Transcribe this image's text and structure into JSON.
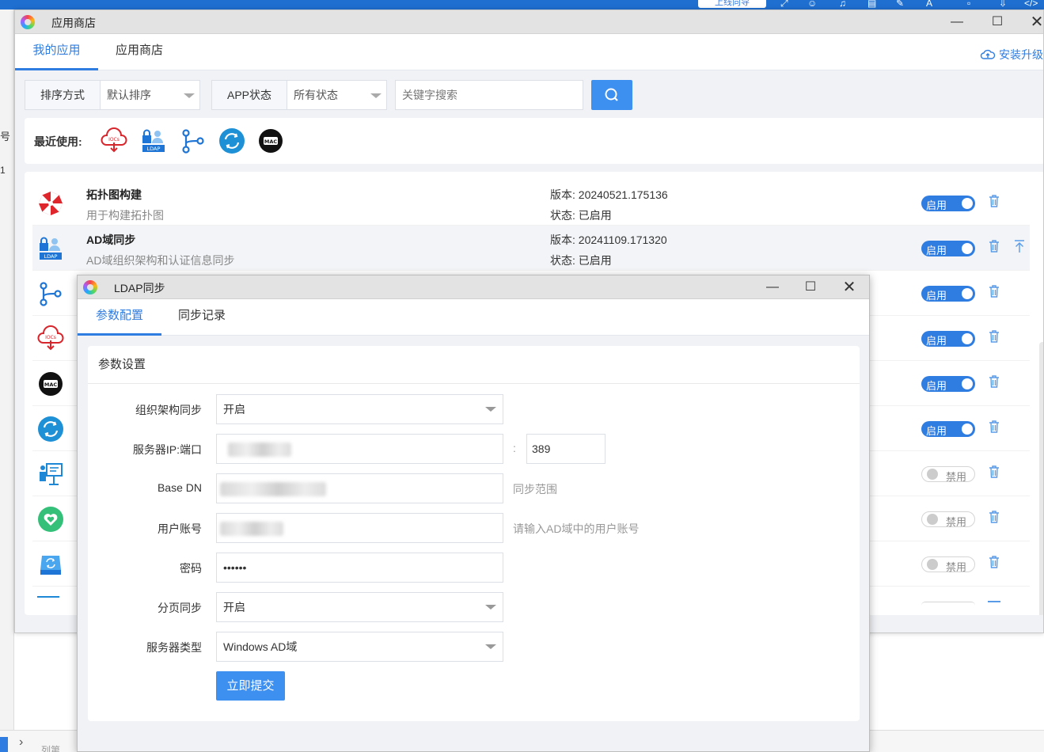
{
  "background": {
    "top_pill": "上线向导",
    "left_text_1": "号",
    "left_text_2": "1",
    "bottom_text": "列第"
  },
  "window": {
    "title": "应用商店",
    "tabs": [
      {
        "label": "我的应用",
        "active": true
      },
      {
        "label": "应用商店",
        "active": false
      }
    ],
    "upgrade_label": "安装升级",
    "filters": {
      "sort_label": "排序方式",
      "sort_value": "默认排序",
      "status_label": "APP状态",
      "status_value": "所有状态",
      "keyword_placeholder": "关键字搜索"
    },
    "recent": {
      "label": "最近使用:",
      "icons": [
        "iocs-cloud-icon",
        "ldap-icon",
        "branch-icon",
        "sync-icon",
        "mac-icon"
      ]
    },
    "apps": [
      {
        "name": "拓扑图构建",
        "desc": "用于构建拓扑图",
        "version_label": "版本:",
        "version": "20240521.175136",
        "status_label": "状态:",
        "status": "已启用",
        "toggle": "启用",
        "enabled": true,
        "icon": "umbrella-icon"
      },
      {
        "name": "AD域同步",
        "desc": "AD域组织架构和认证信息同步",
        "version_label": "版本:",
        "version": "20241109.171320",
        "status_label": "状态:",
        "status": "已启用",
        "toggle": "启用",
        "enabled": true,
        "icon": "ldap-icon"
      },
      {
        "toggle": "启用",
        "enabled": true,
        "icon": "branch-icon"
      },
      {
        "toggle": "启用",
        "enabled": true,
        "icon": "iocs-cloud-icon"
      },
      {
        "toggle": "启用",
        "enabled": true,
        "icon": "mac-icon"
      },
      {
        "toggle": "启用",
        "enabled": true,
        "icon": "sync-icon"
      },
      {
        "toggle": "禁用",
        "enabled": false,
        "icon": "presenter-icon"
      },
      {
        "toggle": "禁用",
        "enabled": false,
        "icon": "heart-shield-icon"
      },
      {
        "toggle": "禁用",
        "enabled": false,
        "icon": "drive-icon"
      }
    ]
  },
  "modal": {
    "title": "LDAP同步",
    "tabs": [
      {
        "label": "参数配置",
        "active": true
      },
      {
        "label": "同步记录",
        "active": false
      }
    ],
    "section_title": "参数设置",
    "fields": {
      "org_sync": {
        "label": "组织架构同步",
        "value": "开启"
      },
      "server": {
        "label": "服务器IP:端口",
        "colon": ":",
        "port": "389"
      },
      "base_dn": {
        "label": "Base DN",
        "hint": "同步范围"
      },
      "account": {
        "label": "用户账号",
        "hint": "请输入AD域中的用户账号"
      },
      "password": {
        "label": "密码",
        "value": "••••••"
      },
      "paging": {
        "label": "分页同步",
        "value": "开启"
      },
      "server_type": {
        "label": "服务器类型",
        "value": "Windows AD域"
      }
    },
    "submit_label": "立即提交"
  },
  "colors": {
    "accent": "#2f7de1",
    "button": "#3d8ff0",
    "title_bar": "#e3e3e3"
  }
}
